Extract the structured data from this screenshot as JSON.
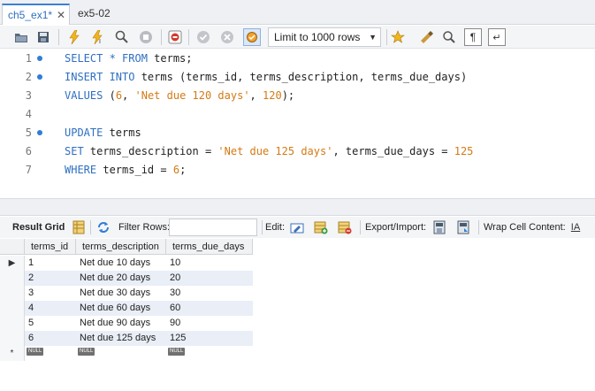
{
  "tabs": [
    {
      "label": "ch5_ex1*",
      "close": "✕"
    },
    {
      "label": "ex5-02"
    }
  ],
  "toolbar": {
    "limit_select_value": "Limit to 1000 rows"
  },
  "editor": {
    "line_numbers": [
      "1",
      "2",
      "3",
      "4",
      "5",
      "6",
      "7"
    ],
    "lines": [
      [
        {
          "t": "SELECT * FROM",
          "k": "kw"
        },
        {
          "t": " terms;",
          "k": ""
        }
      ],
      [
        {
          "t": "INSERT INTO",
          "k": "kw"
        },
        {
          "t": " terms (terms_id, terms_description, terms_due_days)",
          "k": ""
        }
      ],
      [
        {
          "t": "VALUES",
          "k": "kw"
        },
        {
          "t": " (",
          "k": ""
        },
        {
          "t": "6",
          "k": "num"
        },
        {
          "t": ", ",
          "k": ""
        },
        {
          "t": "'Net due 120 days'",
          "k": "str"
        },
        {
          "t": ", ",
          "k": ""
        },
        {
          "t": "120",
          "k": "num"
        },
        {
          "t": ");",
          "k": ""
        }
      ],
      [],
      [
        {
          "t": "UPDATE",
          "k": "kw"
        },
        {
          "t": " terms",
          "k": ""
        }
      ],
      [
        {
          "t": "SET",
          "k": "kw"
        },
        {
          "t": " terms_description = ",
          "k": ""
        },
        {
          "t": "'Net due 125 days'",
          "k": "str"
        },
        {
          "t": ", terms_due_days = ",
          "k": ""
        },
        {
          "t": "125",
          "k": "num"
        }
      ],
      [
        {
          "t": "WHERE",
          "k": "kw"
        },
        {
          "t": " terms_id = ",
          "k": ""
        },
        {
          "t": "6",
          "k": "num"
        },
        {
          "t": ";",
          "k": ""
        }
      ]
    ],
    "dot_lines": [
      0,
      1,
      4
    ]
  },
  "result_toolbar": {
    "result_grid_label": "Result Grid",
    "filter_rows_label": "Filter Rows:",
    "edit_label": "Edit:",
    "export_import_label": "Export/Import:",
    "wrap_label": "Wrap Cell Content:"
  },
  "grid": {
    "columns": [
      "terms_id",
      "terms_description",
      "terms_due_days"
    ],
    "rows": [
      [
        "1",
        "Net due 10 days",
        "10"
      ],
      [
        "2",
        "Net due 20 days",
        "20"
      ],
      [
        "3",
        "Net due 30 days",
        "30"
      ],
      [
        "4",
        "Net due 60 days",
        "60"
      ],
      [
        "5",
        "Net due 90 days",
        "90"
      ],
      [
        "6",
        "Net due 125 days",
        "125"
      ]
    ],
    "current_row_marker": "▶",
    "new_row_marker": "*",
    "null_label": "NULL"
  },
  "colors": {
    "keyword": "#2f6fc1",
    "string": "#d47a15",
    "gutter_dot": "#2f7dd6",
    "alt_row": "#e9eef7"
  }
}
